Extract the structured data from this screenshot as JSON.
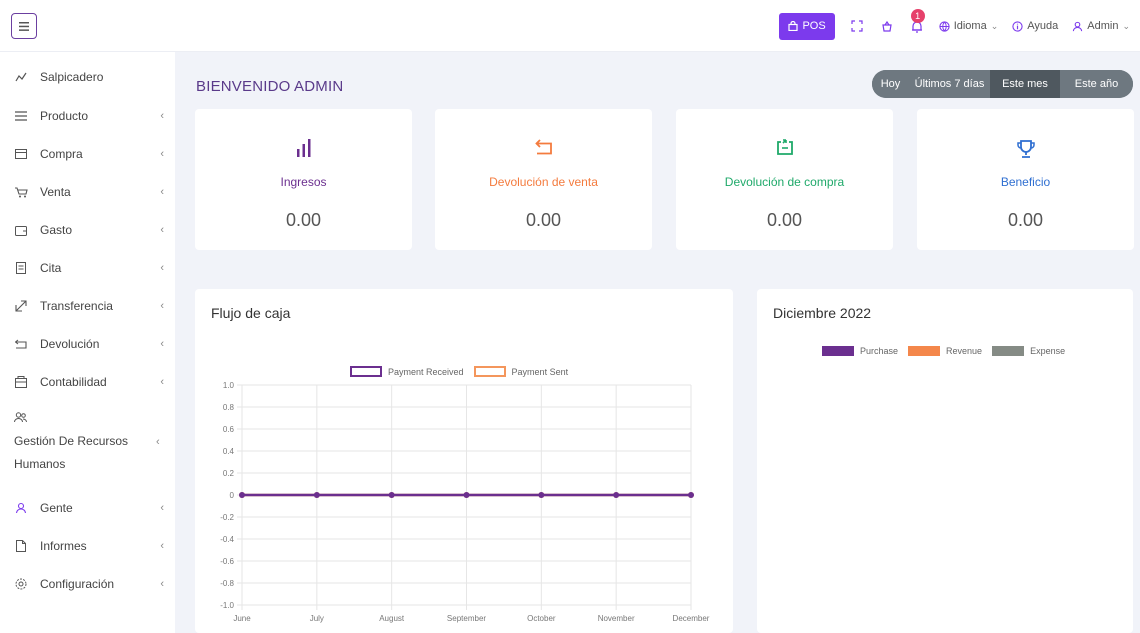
{
  "topbar": {
    "pos_label": "POS",
    "notifications_count": "1",
    "language_label": "Idioma",
    "help_label": "Ayuda",
    "user_label": "Admin"
  },
  "sidebar": {
    "items": [
      {
        "label": "Salpicadero",
        "icon": "dashboard-icon",
        "has_submenu": false
      },
      {
        "label": "Producto",
        "icon": "list-icon",
        "has_submenu": true
      },
      {
        "label": "Compra",
        "icon": "card-icon",
        "has_submenu": true
      },
      {
        "label": "Venta",
        "icon": "cart-icon",
        "has_submenu": true
      },
      {
        "label": "Gasto",
        "icon": "wallet-icon",
        "has_submenu": true
      },
      {
        "label": "Cita",
        "icon": "document-icon",
        "has_submenu": true
      },
      {
        "label": "Transferencia",
        "icon": "transfer-icon",
        "has_submenu": true
      },
      {
        "label": "Devolución",
        "icon": "return-icon",
        "has_submenu": true
      },
      {
        "label": "Contabilidad",
        "icon": "accounting-icon",
        "has_submenu": true
      },
      {
        "label": "Gestión De Recursos",
        "label2": "Humanos",
        "icon": "users-icon",
        "has_submenu": true
      },
      {
        "label": "Gente",
        "icon": "user-icon",
        "has_submenu": true
      },
      {
        "label": "Informes",
        "icon": "file-icon",
        "has_submenu": true
      },
      {
        "label": "Configuración",
        "icon": "settings-icon",
        "has_submenu": true
      }
    ],
    "chevron": "‹"
  },
  "main": {
    "welcome": "BIENVENIDO ADMIN",
    "ranges": [
      "Hoy",
      "Últimos 7 días",
      "Este mes",
      "Este año"
    ],
    "active_range": "Este mes",
    "cards": [
      {
        "label": "Ingresos",
        "value": "0.00",
        "icon": "bar-chart-icon",
        "color": "#6b2f8f"
      },
      {
        "label": "Devolución de venta",
        "value": "0.00",
        "icon": "return-arrow-icon",
        "color": "#f47b3e"
      },
      {
        "label": "Devolución de compra",
        "value": "0.00",
        "icon": "purchase-return-icon",
        "color": "#1fa96a"
      },
      {
        "label": "Beneficio",
        "value": "0.00",
        "icon": "trophy-icon",
        "color": "#2f6fd1"
      }
    ]
  },
  "cashflow": {
    "title": "Flujo de caja",
    "chart_data": {
      "type": "line",
      "categories": [
        "June",
        "July",
        "August",
        "September",
        "October",
        "November",
        "December"
      ],
      "series": [
        {
          "name": "Payment Received",
          "values": [
            0,
            0,
            0,
            0,
            0,
            0,
            0
          ],
          "color": "#6b2f8f"
        },
        {
          "name": "Payment Sent",
          "values": [
            0,
            0,
            0,
            0,
            0,
            0,
            0
          ],
          "color": "#f4965c"
        }
      ],
      "ylim": [
        -1.0,
        1.0
      ],
      "yticks": [
        "1.0",
        "0.8",
        "0.6",
        "0.4",
        "0.2",
        "0",
        "-0.2",
        "-0.4",
        "-0.6",
        "-0.8",
        "-1.0"
      ],
      "grid": true,
      "legend": "top"
    }
  },
  "month_panel": {
    "title": "Diciembre 2022",
    "chart_data": {
      "type": "bar",
      "series": [
        {
          "name": "Purchase",
          "values": [],
          "color": "#6b2f8f"
        },
        {
          "name": "Revenue",
          "values": [],
          "color": "#f4874b"
        },
        {
          "name": "Expense",
          "values": [],
          "color": "#858b85"
        }
      ],
      "legend": "top"
    }
  }
}
